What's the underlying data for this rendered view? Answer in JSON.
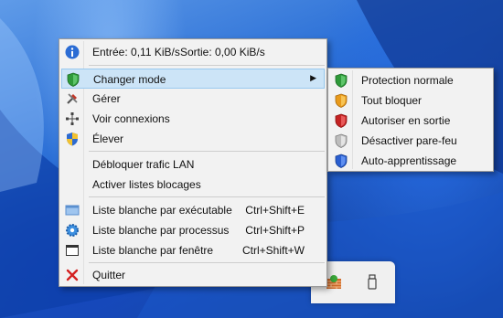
{
  "menu": {
    "status_in": "Entrée: 0,11 KiB/s",
    "status_out": "Sortie: 0,00 KiB/s",
    "change_mode": "Changer mode",
    "manage": "Gérer",
    "view_connections": "Voir connexions",
    "elevate": "Élever",
    "unblock_lan": "Débloquer trafic LAN",
    "enable_blocklists": "Activer listes blocages",
    "whitelist_exe": "Liste blanche par exécutable",
    "whitelist_exe_shortcut": "Ctrl+Shift+E",
    "whitelist_proc": "Liste blanche par processus",
    "whitelist_proc_shortcut": "Ctrl+Shift+P",
    "whitelist_win": "Liste blanche par fenêtre",
    "whitelist_win_shortcut": "Ctrl+Shift+W",
    "quit": "Quitter"
  },
  "submenu": {
    "normal": "Protection normale",
    "block_all": "Tout bloquer",
    "allow_out": "Autoriser en sortie",
    "disable": "Désactiver pare-feu",
    "learning": "Auto-apprentissage"
  },
  "icons": {
    "info": "info-icon",
    "shield_green": "shield-green-icon",
    "tools": "tools-icon",
    "network": "network-icon",
    "uac_shield": "uac-shield-icon",
    "whitelist_exe": "exe-icon",
    "gear": "gear-icon",
    "window": "window-icon",
    "close": "close-x-icon"
  }
}
